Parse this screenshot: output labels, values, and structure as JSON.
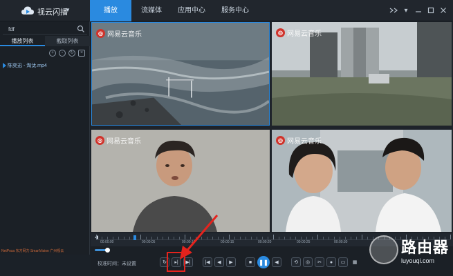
{
  "app": {
    "title": "视云闪播"
  },
  "nav": {
    "tabs": [
      {
        "label": "播放"
      },
      {
        "label": "流媒体"
      },
      {
        "label": "应用中心"
      },
      {
        "label": "服务中心"
      }
    ]
  },
  "sidebar": {
    "search_value": "fdf",
    "tabs": [
      {
        "label": "播放列表"
      },
      {
        "label": "截取列表"
      }
    ],
    "items": [
      {
        "label": "陈奕迅 - 淘汰.mp4"
      }
    ],
    "brand": "NetPosa 东方网力 SmartVision 广州视云"
  },
  "videos": [
    {
      "watermark": "网易云音乐"
    },
    {
      "watermark": "网易云音乐"
    },
    {
      "watermark": "网易云音乐"
    },
    {
      "watermark": "网易云音乐"
    }
  ],
  "timeline": {
    "labels": [
      "00:00:00",
      "00:00:05",
      "00:00:10",
      "00:00:15",
      "00:00:20",
      "00:00:25",
      "00:00:30"
    ]
  },
  "controls": {
    "calibration_label": "校准时间：",
    "calibration_value": "未设置"
  },
  "watermark": {
    "name": "路由器",
    "url": "luyouqi.com"
  },
  "colors": {
    "accent": "#2a8ae0",
    "highlight": "#e5231d"
  }
}
